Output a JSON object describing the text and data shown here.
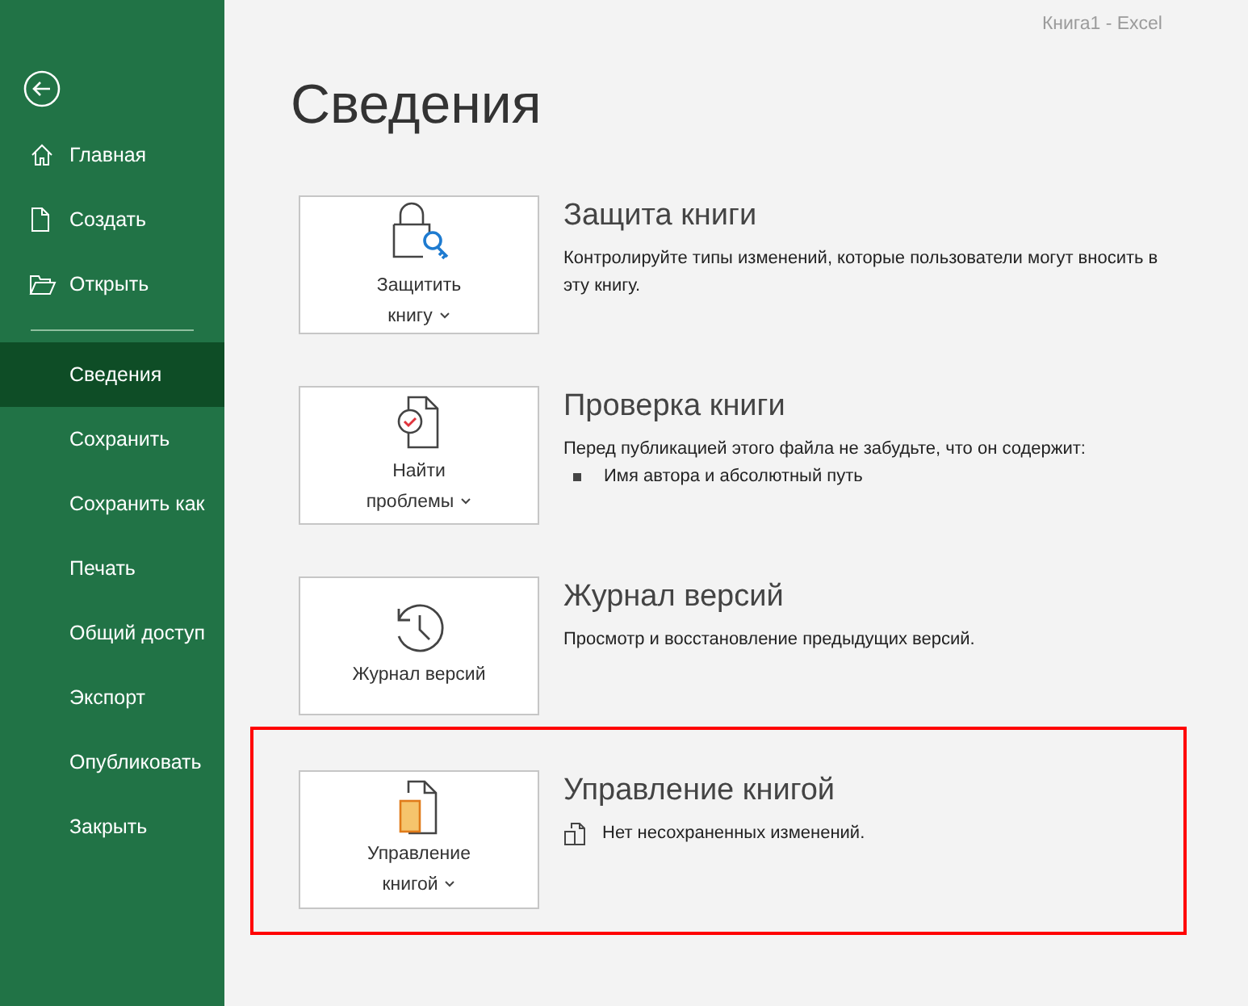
{
  "window": {
    "title": "Книга1  -  Excel"
  },
  "sidebar": {
    "items": [
      {
        "label": "Главная",
        "selected": false
      },
      {
        "label": "Создать",
        "selected": false
      },
      {
        "label": "Открыть",
        "selected": false
      },
      {
        "label": "Сведения",
        "selected": true
      },
      {
        "label": "Сохранить",
        "selected": false
      },
      {
        "label": "Сохранить как",
        "selected": false
      },
      {
        "label": "Печать",
        "selected": false
      },
      {
        "label": "Общий доступ",
        "selected": false
      },
      {
        "label": "Экспорт",
        "selected": false
      },
      {
        "label": "Опубликовать",
        "selected": false
      },
      {
        "label": "Закрыть",
        "selected": false
      }
    ]
  },
  "page": {
    "heading": "Сведения"
  },
  "sections": [
    {
      "button": {
        "label_lines": [
          "Защитить",
          "книгу"
        ],
        "dropdown": true
      },
      "title": "Защита книги",
      "highlighted": false,
      "details": [
        {
          "kind": "text",
          "text": "Контролируйте типы изменений, которые пользователи могут вносить в эту книгу."
        }
      ]
    },
    {
      "button": {
        "label_lines": [
          "Найти",
          "проблемы"
        ],
        "dropdown": true
      },
      "title": "Проверка книги",
      "highlighted": false,
      "details": [
        {
          "kind": "text",
          "text": "Перед публикацией этого файла не забудьте, что он содержит:"
        },
        {
          "kind": "bullet",
          "text": "Имя автора и абсолютный путь"
        }
      ]
    },
    {
      "button": {
        "label_lines": [
          "Журнал версий"
        ],
        "dropdown": false
      },
      "title": "Журнал версий",
      "highlighted": false,
      "details": [
        {
          "kind": "text",
          "text": "Просмотр и восстановление предыдущих версий."
        }
      ]
    },
    {
      "button": {
        "label_lines": [
          "Управление",
          "книгой"
        ],
        "dropdown": true
      },
      "title": "Управление книгой",
      "highlighted": true,
      "details": [
        {
          "kind": "status",
          "text": "Нет несохраненных изменений."
        }
      ]
    }
  ]
}
